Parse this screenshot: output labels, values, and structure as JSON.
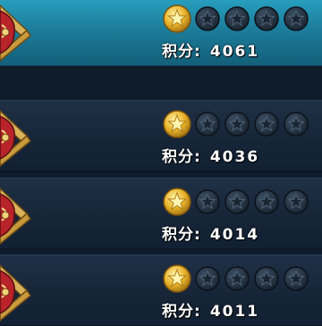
{
  "rows": [
    {
      "score_label": "积分:",
      "score_value": "4061",
      "stars_earned": 1,
      "stars_total": 5,
      "selected": true
    },
    {
      "score_label": "积分:",
      "score_value": "4036",
      "stars_earned": 1,
      "stars_total": 5,
      "selected": false
    },
    {
      "score_label": "积分:",
      "score_value": "4014",
      "stars_earned": 1,
      "stars_total": 5,
      "selected": false
    },
    {
      "score_label": "积分:",
      "score_value": "4011",
      "stars_earned": 1,
      "stars_total": 5,
      "selected": false
    }
  ],
  "icons": {
    "emblem": "crossed-swords-emblem-icon",
    "star_earned": "gold-star-icon",
    "star_empty": "empty-star-icon"
  },
  "colors": {
    "selected_row": "#1d7f9d",
    "row": "#172538",
    "star_gold": "#f2c23a"
  }
}
